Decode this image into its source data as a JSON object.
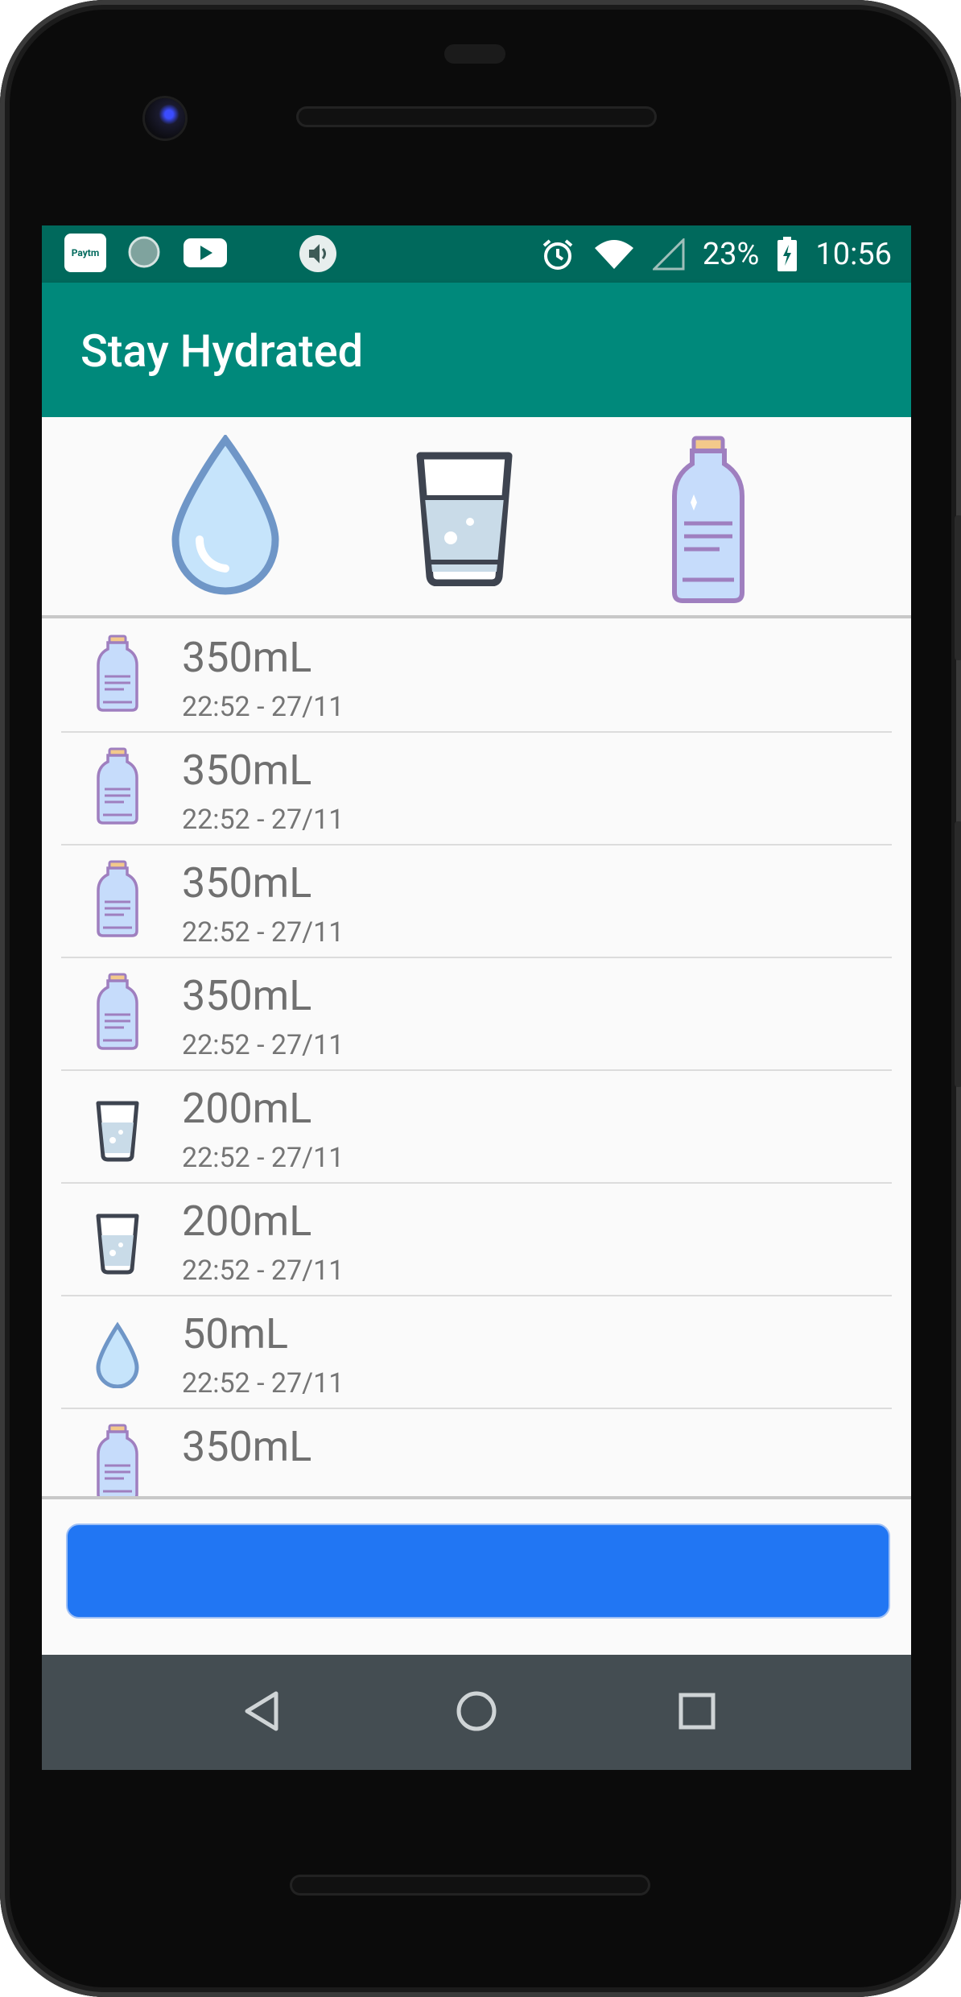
{
  "status_bar": {
    "battery": "23%",
    "time": "10:56",
    "icons": [
      "paytm-icon",
      "sync-icon",
      "youtube-icon",
      "volume-icon",
      "alarm-icon",
      "wifi-icon",
      "signal-icon",
      "battery-charging-icon"
    ],
    "paytm_text": "Paytm"
  },
  "app_bar": {
    "title": "Stay Hydrated"
  },
  "picker": {
    "options": [
      "drop-icon",
      "glass-icon",
      "bottle-icon"
    ]
  },
  "entries": [
    {
      "icon": "bottle-icon",
      "amount": "350mL",
      "time": "22:52 - 27/11"
    },
    {
      "icon": "bottle-icon",
      "amount": "350mL",
      "time": "22:52 - 27/11"
    },
    {
      "icon": "bottle-icon",
      "amount": "350mL",
      "time": "22:52 - 27/11"
    },
    {
      "icon": "bottle-icon",
      "amount": "350mL",
      "time": "22:52 - 27/11"
    },
    {
      "icon": "glass-icon",
      "amount": "200mL",
      "time": "22:52 - 27/11"
    },
    {
      "icon": "glass-icon",
      "amount": "200mL",
      "time": "22:52 - 27/11"
    },
    {
      "icon": "drop-icon",
      "amount": "50mL",
      "time": "22:52 - 27/11"
    },
    {
      "icon": "bottle-icon",
      "amount": "350mL",
      "time": ""
    }
  ],
  "add_button": {
    "label": ""
  },
  "navigation": [
    "back-icon",
    "home-icon",
    "recents-icon"
  ],
  "colors": {
    "status_bar": "#00695c",
    "app_bar": "#00897b",
    "button": "#2176f3",
    "nav_bar": "#444d52"
  }
}
